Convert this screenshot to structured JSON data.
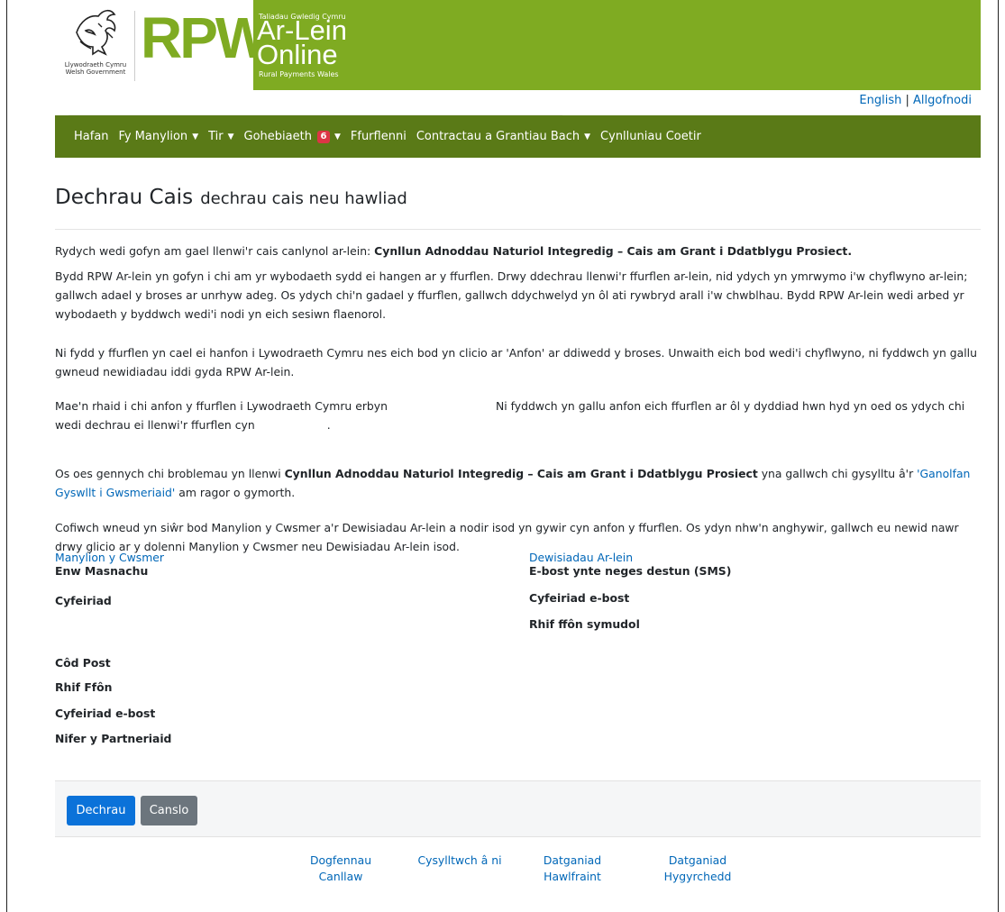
{
  "banner": {
    "wg_line1": "Llywodraeth Cymru",
    "wg_line2": "Welsh Government",
    "rpw": "RPW",
    "small_top": "Taliadau Gwledig Cymru",
    "ar_lein": "Ar-Lein",
    "online": "Online",
    "small_bottom": "Rural Payments Wales",
    "accent": "#7fab22"
  },
  "top_links": {
    "english": "English",
    "separator": "|",
    "logout": "Allgofnodi"
  },
  "nav": {
    "bg": "#5a7a17",
    "hafan": "Hafan",
    "fy_manylion": "Fy Manylion",
    "tir": "Tir",
    "gohebiaeth": "Gohebiaeth",
    "gohebiaeth_badge": "6",
    "ffurflenni": "Ffurflenni",
    "contractau": "Contractau a Grantiau Bach",
    "cynlluniau": "Cynlluniau Coetir",
    "caret": "▼"
  },
  "page": {
    "title": "Dechrau Cais",
    "subtitle": "dechrau cais neu hawliad"
  },
  "content": {
    "p1_text": "Rydych wedi gofyn am gael llenwi'r cais canlynol ar-lein: ",
    "p1_bold": "Cynllun Adnoddau Naturiol Integredig – Cais am Grant i Ddatblygu Prosiect.",
    "p2": "Bydd RPW Ar-lein yn gofyn i chi am yr wybodaeth sydd ei hangen ar y ffurflen. Drwy ddechrau llenwi'r ffurflen ar-lein, nid ydych yn ymrwymo i'w chyflwyno ar-lein; gallwch adael y broses ar unrhyw adeg. Os ydych chi'n gadael y ffurflen, gallwch ddychwelyd yn ôl ati rywbryd arall i'w chwblhau. Bydd RPW Ar-lein wedi arbed yr wybodaeth y byddwch wedi'i nodi yn eich sesiwn flaenorol.",
    "p3": "Ni fydd y ffurflen yn cael ei hanfon i Lywodraeth Cymru nes eich bod yn clicio ar 'Anfon' ar ddiwedd y broses. Unwaith eich bod wedi'i chyflwyno, ni fyddwch yn gallu gwneud newidiadau iddi gyda RPW Ar-lein.",
    "p4_a": "Mae'n rhaid i chi anfon y ffurflen i Lywodraeth Cymru erbyn",
    "p4_b": "Ni fyddwch yn gallu anfon eich ffurflen ar ôl y dyddiad hwn hyd yn oed os ydych chi wedi dechrau ei llenwi'r ffurflen cyn",
    "p4_c": ".",
    "p5_a": "Os oes gennych chi broblemau yn llenwi ",
    "p5_bold": "Cynllun Adnoddau Naturiol Integredig – Cais am Grant i Ddatblygu Prosiect",
    "p5_b": " yna gallwch chi gysylltu â'r ",
    "p5_link": "'Ganolfan Gyswllt i Gwsmeriaid'",
    "p5_c": " am ragor o gymorth.",
    "p6": "Cofiwch wneud yn siŵr bod Manylion y Cwsmer a'r Dewisiadau Ar-lein a nodir isod yn gywir cyn anfon y ffurflen. Os ydyn nhw'n anghywir, gallwch eu newid nawr drwy glicio ar y dolenni Manylion y Cwsmer neu Dewisiadau Ar-lein isod."
  },
  "customer": {
    "heading": "Manylion y Cwsmer",
    "trading_name": "Enw Masnachu",
    "address": "Cyfeiriad",
    "postcode": "Côd Post",
    "phone": "Rhif Ffôn",
    "email": "Cyfeiriad e-bost",
    "partners": "Nifer y Partneriaid"
  },
  "online_prefs": {
    "heading": "Dewisiadau Ar-lein",
    "contact": "E-bost ynte neges destun (SMS)",
    "email": "Cyfeiriad e-bost",
    "mobile": "Rhif ffôn symudol"
  },
  "buttons": {
    "start": "Dechrau",
    "cancel": "Canslo"
  },
  "footer": {
    "docs_1": "Dogfennau",
    "docs_2": "Canllaw",
    "contact": "Cysylltwch â ni",
    "copyright_1": "Datganiad",
    "copyright_2": "Hawlfraint",
    "access_1": "Datganiad",
    "access_2": "Hygyrchedd"
  }
}
